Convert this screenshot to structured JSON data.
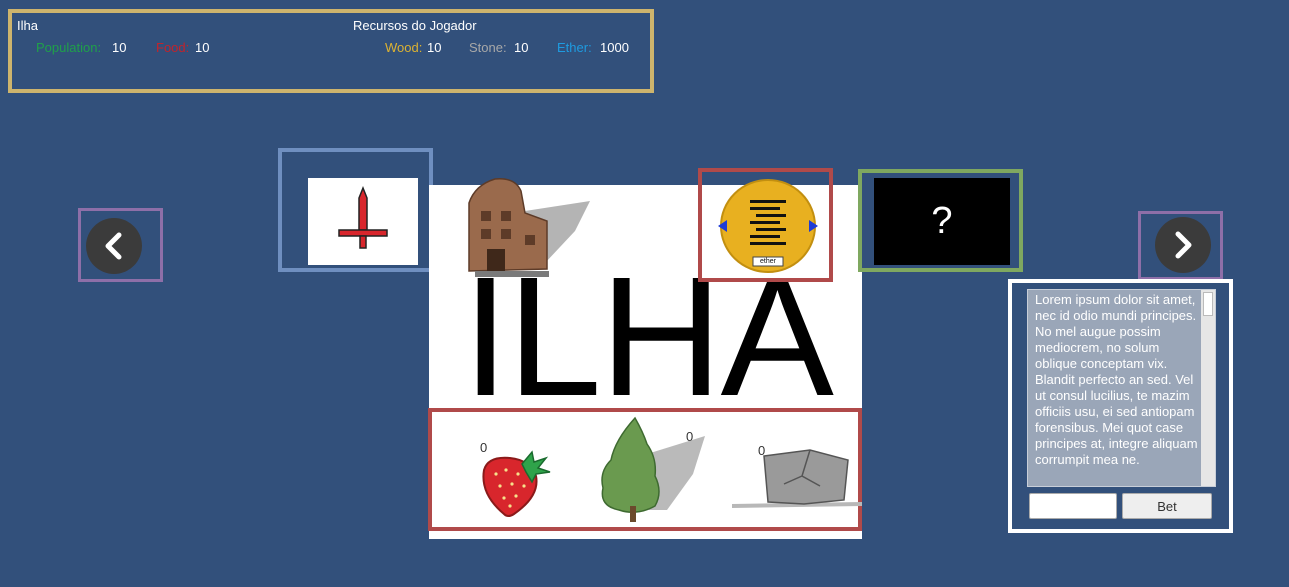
{
  "hud": {
    "island_name": "Ilha",
    "player_resources_title": "Recursos do Jogador",
    "population_label": "Population:",
    "population_value": "10",
    "food_label": "Food:",
    "food_value": "10",
    "wood_label": "Wood:",
    "wood_value": "10",
    "stone_label": "Stone:",
    "stone_value": "10",
    "ether_label": "Ether:",
    "ether_value": "1000"
  },
  "colors": {
    "background": "#32507b",
    "population": "#1fa04a",
    "food": "#c2232b",
    "wood": "#dcb232",
    "stone": "#a8a8a8",
    "ether": "#1e9be0"
  },
  "island": {
    "title": "ILHA",
    "resources": [
      {
        "name": "strawberry-icon",
        "count": "0"
      },
      {
        "name": "tree-icon",
        "count": "0"
      },
      {
        "name": "rock-icon",
        "count": "0"
      }
    ]
  },
  "cards": {
    "sword_icon": "sword-icon",
    "ether_coin_label": "ether",
    "mystery_card_text": "?"
  },
  "nav": {
    "prev_icon": "chevron-left-icon",
    "next_icon": "chevron-right-icon"
  },
  "bet_panel": {
    "lorem": "Lorem ipsum dolor sit amet, nec id odio mundi principes. No mel augue possim mediocrem, no solum oblique conceptam vix. Blandit perfecto an sed. Vel ut consul lucilius, te mazim officiis usu, ei sed antiopam forensibus. Mei quot case principes at, integre aliquam corrumpit mea ne.",
    "bet_input_value": "",
    "bet_button_label": "Bet"
  }
}
